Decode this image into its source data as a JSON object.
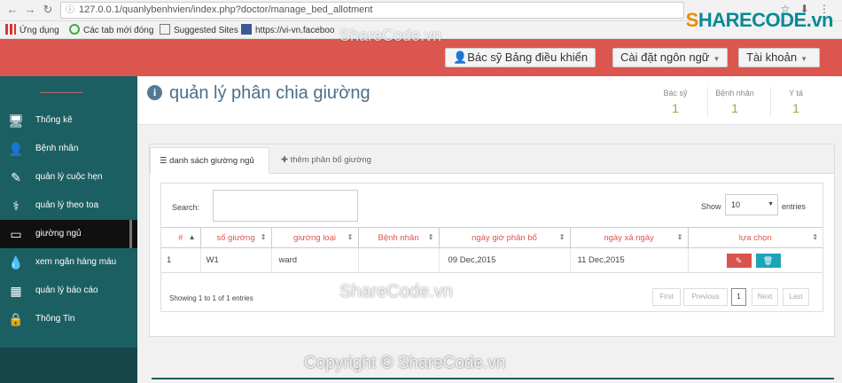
{
  "browser": {
    "url": "127.0.0.1/quanlybenhvien/index.php?doctor/manage_bed_allotment",
    "bookmarks": [
      "Ứng dụng",
      "Các tab mới đóng",
      "Suggested Sites",
      "https://vi-vn.faceboo"
    ]
  },
  "logo": {
    "brand_s": "S",
    "brand_rest": "HARECODE.vn"
  },
  "header": {
    "doctor_dashboard": "Bác sỹ Bảng điều khiển",
    "language": "Cài đặt ngôn ngữ",
    "account": "Tài khoản"
  },
  "sidebar": {
    "items": [
      {
        "label": "Thống kê",
        "icon": "monitor-icon"
      },
      {
        "label": "Bệnh nhân",
        "icon": "user-icon"
      },
      {
        "label": "quản lý cuộc hẹn",
        "icon": "edit-icon"
      },
      {
        "label": "quản lý theo toa",
        "icon": "stethoscope-icon"
      },
      {
        "label": "giường ngủ",
        "icon": "bed-icon"
      },
      {
        "label": "xem ngân hàng máu",
        "icon": "blood-drop-icon"
      },
      {
        "label": "quản lý báo cáo",
        "icon": "building-icon"
      },
      {
        "label": "Thông Tin",
        "icon": "lock-icon"
      }
    ]
  },
  "page": {
    "title": "quản lý phân chia giường",
    "stats": [
      {
        "label": "Bác sỹ",
        "value": "1"
      },
      {
        "label": "Bệnh nhân",
        "value": "1"
      },
      {
        "label": "Y tá",
        "value": "1"
      }
    ]
  },
  "tabs": {
    "list": "danh sách giường ngủ",
    "add": "thêm phân bổ giường"
  },
  "table": {
    "search_label": "Search:",
    "show_label": "Show",
    "show_value": "10",
    "entries_label": "entries",
    "columns": [
      "#",
      "số giường",
      "giường loại",
      "Bệnh nhân",
      "ngày giờ phân bổ",
      "ngày xả ngày",
      "lựa chọn"
    ],
    "rows": [
      {
        "num": "1",
        "bed_no": "W1",
        "bed_type": "ward",
        "patient": "",
        "allotted": "09 Dec,2015",
        "discharge": "11 Dec,2015"
      }
    ],
    "info": "Showing 1 to 1 of 1 entries",
    "pagination": {
      "first": "First",
      "previous": "Previous",
      "current": "1",
      "next": "Next",
      "last": "Last"
    }
  },
  "watermarks": {
    "top": "ShareCode.vn",
    "middle": "ShareCode.vn",
    "bottom": "Copyright © ShareCode.vn"
  },
  "colors": {
    "header": "#dc5650",
    "sidebar": "#1c5f63",
    "accent_title": "#4a6f8a",
    "column_header": "#dc5650",
    "stat_value": "#9aa84f"
  }
}
